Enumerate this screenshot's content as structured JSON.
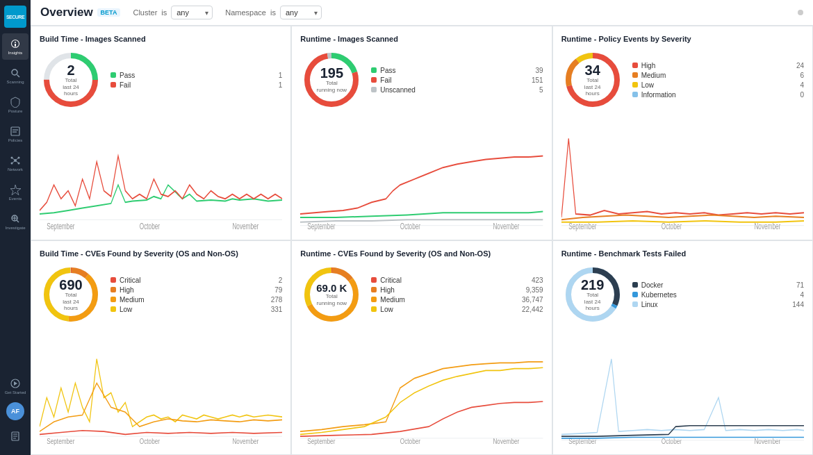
{
  "app": {
    "title": "Overview",
    "beta": "BETA",
    "logo": "SECURE"
  },
  "filters": {
    "cluster_label": "Cluster",
    "cluster_op": "is",
    "cluster_value": "any",
    "namespace_label": "Namespace",
    "namespace_op": "is",
    "namespace_value": "any"
  },
  "sidebar": {
    "items": [
      {
        "label": "Insights",
        "icon": "insights"
      },
      {
        "label": "Scanning",
        "icon": "scanning"
      },
      {
        "label": "Posture",
        "icon": "posture"
      },
      {
        "label": "Policies",
        "icon": "policies"
      },
      {
        "label": "Network",
        "icon": "network"
      },
      {
        "label": "Events",
        "icon": "events"
      },
      {
        "label": "Investigate",
        "icon": "investigate"
      }
    ],
    "bottom": [
      {
        "label": "Get Started",
        "icon": "get-started"
      }
    ],
    "avatar": "AF"
  },
  "cards": [
    {
      "id": "build-images-scanned",
      "title": "Build Time - Images Scanned",
      "total": "2",
      "total_label": "Total\nlast 24 hours",
      "legend": [
        {
          "color": "#2ecc71",
          "name": "Pass",
          "value": "1"
        },
        {
          "color": "#e74c3c",
          "name": "Fail",
          "value": "1"
        }
      ],
      "donut_segments": [
        {
          "color": "#2ecc71",
          "pct": 50
        },
        {
          "color": "#e74c3c",
          "pct": 50
        }
      ],
      "x_labels": [
        "September",
        "October",
        "November"
      ],
      "lines": [
        {
          "color": "#2ecc71",
          "id": "build-pass"
        },
        {
          "color": "#e74c3c",
          "id": "build-fail"
        }
      ]
    },
    {
      "id": "runtime-images-scanned",
      "title": "Runtime - Images Scanned",
      "total": "195",
      "total_label": "Total\nrunning now",
      "legend": [
        {
          "color": "#2ecc71",
          "name": "Pass",
          "value": "39"
        },
        {
          "color": "#e74c3c",
          "name": "Fail",
          "value": "151"
        },
        {
          "color": "#bdc3c7",
          "name": "Unscanned",
          "value": "5"
        }
      ],
      "donut_segments": [
        {
          "color": "#2ecc71",
          "pct": 20
        },
        {
          "color": "#e74c3c",
          "pct": 77
        },
        {
          "color": "#bdc3c7",
          "pct": 3
        }
      ],
      "x_labels": [
        "September",
        "October",
        "November"
      ],
      "lines": [
        {
          "color": "#2ecc71",
          "id": "rt-pass"
        },
        {
          "color": "#e74c3c",
          "id": "rt-fail"
        },
        {
          "color": "#bdc3c7",
          "id": "rt-unscanned"
        }
      ]
    },
    {
      "id": "runtime-policy-events",
      "title": "Runtime - Policy Events by Severity",
      "total": "34",
      "total_label": "Total\nlast 24 hours",
      "legend": [
        {
          "color": "#e74c3c",
          "name": "High",
          "value": "24"
        },
        {
          "color": "#e67e22",
          "name": "Medium",
          "value": "6"
        },
        {
          "color": "#f1c40f",
          "name": "Low",
          "value": "4"
        },
        {
          "color": "#85c1e9",
          "name": "Information",
          "value": "0"
        }
      ],
      "donut_segments": [
        {
          "color": "#e74c3c",
          "pct": 71
        },
        {
          "color": "#e67e22",
          "pct": 18
        },
        {
          "color": "#f1c40f",
          "pct": 11
        },
        {
          "color": "#85c1e9",
          "pct": 0
        }
      ],
      "x_labels": [
        "September",
        "October",
        "November"
      ],
      "lines": [
        {
          "color": "#e74c3c",
          "id": "pol-high"
        },
        {
          "color": "#e67e22",
          "id": "pol-medium"
        },
        {
          "color": "#f1c40f",
          "id": "pol-low"
        },
        {
          "color": "#85c1e9",
          "id": "pol-info"
        }
      ]
    },
    {
      "id": "build-cves",
      "title": "Build Time - CVEs Found by Severity (OS and Non-OS)",
      "total": "690",
      "total_label": "Total\nlast 24 hours",
      "legend": [
        {
          "color": "#e74c3c",
          "name": "Critical",
          "value": "2"
        },
        {
          "color": "#e67e22",
          "name": "High",
          "value": "79"
        },
        {
          "color": "#f39c12",
          "name": "Medium",
          "value": "278"
        },
        {
          "color": "#f1c40f",
          "name": "Low",
          "value": "331"
        }
      ],
      "donut_segments": [
        {
          "color": "#e74c3c",
          "pct": 0.3
        },
        {
          "color": "#e67e22",
          "pct": 11
        },
        {
          "color": "#f39c12",
          "pct": 40
        },
        {
          "color": "#f1c40f",
          "pct": 48
        }
      ],
      "x_labels": [
        "September",
        "October",
        "November"
      ],
      "lines": [
        {
          "color": "#e74c3c",
          "id": "bcve-crit"
        },
        {
          "color": "#e67e22",
          "id": "bcve-high"
        },
        {
          "color": "#f39c12",
          "id": "bcve-med"
        },
        {
          "color": "#f1c40f",
          "id": "bcve-low"
        }
      ]
    },
    {
      "id": "runtime-cves",
      "title": "Runtime - CVEs Found by Severity (OS and Non-OS)",
      "total": "69.0 K",
      "total_label": "Total\nrunning now",
      "legend": [
        {
          "color": "#e74c3c",
          "name": "Critical",
          "value": "423"
        },
        {
          "color": "#e67e22",
          "name": "High",
          "value": "9,359"
        },
        {
          "color": "#f39c12",
          "name": "Medium",
          "value": "36,747"
        },
        {
          "color": "#f1c40f",
          "name": "Low",
          "value": "22,442"
        }
      ],
      "donut_segments": [
        {
          "color": "#e74c3c",
          "pct": 0.6
        },
        {
          "color": "#e67e22",
          "pct": 14
        },
        {
          "color": "#f39c12",
          "pct": 53
        },
        {
          "color": "#f1c40f",
          "pct": 32
        }
      ],
      "x_labels": [
        "September",
        "October",
        "November"
      ],
      "lines": [
        {
          "color": "#e74c3c",
          "id": "rcve-crit"
        },
        {
          "color": "#e67e22",
          "id": "rcve-high"
        },
        {
          "color": "#f39c12",
          "id": "rcve-med"
        },
        {
          "color": "#f1c40f",
          "id": "rcve-low"
        }
      ]
    },
    {
      "id": "runtime-benchmark",
      "title": "Runtime - Benchmark Tests Failed",
      "total": "219",
      "total_label": "Total\nlast 24 hours",
      "legend": [
        {
          "color": "#2c3e50",
          "name": "Docker",
          "value": "71"
        },
        {
          "color": "#3498db",
          "name": "Kubernetes",
          "value": "4"
        },
        {
          "color": "#85c1e9",
          "name": "Linux",
          "value": "144"
        }
      ],
      "donut_segments": [
        {
          "color": "#2c3e50",
          "pct": 32
        },
        {
          "color": "#3498db",
          "pct": 2
        },
        {
          "color": "#aed6f1",
          "pct": 66
        }
      ],
      "x_labels": [
        "September",
        "October",
        "November"
      ],
      "lines": [
        {
          "color": "#2c3e50",
          "id": "bench-docker"
        },
        {
          "color": "#3498db",
          "id": "bench-k8s"
        },
        {
          "color": "#85c1e9",
          "id": "bench-linux"
        }
      ]
    }
  ]
}
